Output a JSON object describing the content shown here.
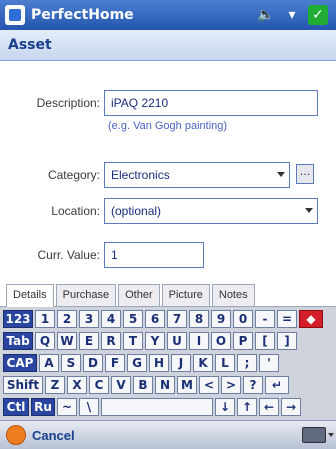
{
  "titlebar": {
    "app_name": "PerfectHome"
  },
  "page": {
    "title": "Asset"
  },
  "form": {
    "description_label": "Description:",
    "description_value": "iPAQ 2210",
    "description_hint": "(e.g. Van Gogh painting)",
    "category_label": "Category:",
    "category_value": "Electronics",
    "ellipsis_label": "...",
    "location_label": "Location:",
    "location_value": "(optional)",
    "value_label": "Curr. Value:",
    "value_value": "1"
  },
  "tabs": [
    "Details",
    "Purchase",
    "Other",
    "Picture",
    "Notes"
  ],
  "keyboard": {
    "row1": [
      "123",
      "1",
      "2",
      "3",
      "4",
      "5",
      "6",
      "7",
      "8",
      "9",
      "0",
      "-",
      "=",
      "◆"
    ],
    "row2": [
      "Tab",
      "Q",
      "W",
      "E",
      "R",
      "T",
      "Y",
      "U",
      "I",
      "O",
      "P",
      "[",
      "]"
    ],
    "row3": [
      "CAP",
      "A",
      "S",
      "D",
      "F",
      "G",
      "H",
      "J",
      "K",
      "L",
      ";",
      "'"
    ],
    "row4": [
      "Shift",
      "Z",
      "X",
      "C",
      "V",
      "B",
      "N",
      "M",
      "<",
      ">",
      "?",
      "↵"
    ],
    "row5": [
      "Ctl",
      "Ru",
      "~",
      "\\",
      "",
      "↓",
      "↑",
      "←",
      "→"
    ]
  },
  "bottom": {
    "cancel_label": "Cancel"
  },
  "colors": {
    "titlebar": "#2456ae",
    "accent": "#1a3f8c",
    "ok": "#1fae33"
  }
}
